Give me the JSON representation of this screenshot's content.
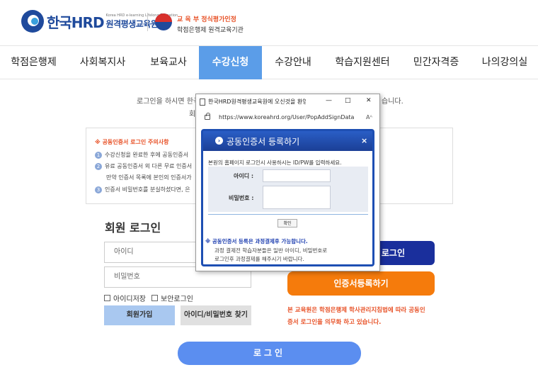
{
  "header": {
    "logo_text": "한국HRD",
    "logo_tiny": "Korea HRD e-learning Lifelong Education",
    "logo_name": "원격평생교육원",
    "cert_top": "교 육 부   정식평가인정",
    "cert_bottom": "학점은행제 원격교육기관"
  },
  "nav": {
    "items": [
      "학점은행제",
      "사회복지사",
      "보육교사",
      "수강신청",
      "수강안내",
      "학습지원센터",
      "민간자격증",
      "나의강의실"
    ],
    "active_index": 3
  },
  "intro": {
    "line1_left": "로그인을 하시면 한국",
    "line1_right": "습니다.",
    "line2": "회"
  },
  "notice": {
    "title": "※ 공동인증서 로그인 주의사항",
    "items": [
      {
        "num": "1",
        "text": "수강신청을 완료한 후에 공동인증서"
      },
      {
        "num": "2",
        "text": "유료 공동인증서 외 다른 무료 인증서"
      },
      {
        "num": "",
        "text": "만약 인증서 목록에 본인의 인증서가"
      },
      {
        "num": "3",
        "text": "인증서 비밀번호를 분실하셨다면, 은"
      }
    ]
  },
  "login": {
    "title": "회원 로그인",
    "id_placeholder": "아이디",
    "pw_placeholder": "비밀번호",
    "save_id_label": "아이디저장",
    "secure_login_label": "보안로그인",
    "join_button": "회원가입",
    "find_button": "아이디/비밀번호 찾기",
    "big_login_button": "로그인"
  },
  "cert": {
    "cert_login_button": "로그인",
    "cert_register_button": "인증서등록하기",
    "note_line1": "본 교육원은 학점은행제 학사관리지침법에 따라 공동인",
    "note_line2": "증서 로그인을 의무화 하고 있습니다."
  },
  "popup": {
    "window_title": "한국HRD원격평생교육원에 오신것을 환영…",
    "url": "https://www.koreahrd.org/User/PopAddSignData",
    "zoom_glyph": "Aᴬ",
    "panel_title": "공동인증서 등록하기",
    "close_glyph": "×",
    "description": "본원의 홈페이지 로그인시 사용하시는 ID/PW를 입력하세요.",
    "id_label": "아이디 :",
    "pw_label": "비밀번호 :",
    "ok_button": "확인",
    "note_title": "※  공동인증서 등록은 과정결제후 가능합니다.",
    "note_line1": "과정 결제전 학습자분들은 일반 아이디, 비밀번호로",
    "note_line2": "로그인후 과정결제를 해주시기 바랍니다."
  },
  "colors": {
    "brand_blue": "#1f4a9c",
    "nav_active": "#5b9de8",
    "orange": "#f57b0c",
    "dark_blue_button": "#1a2f9c"
  }
}
